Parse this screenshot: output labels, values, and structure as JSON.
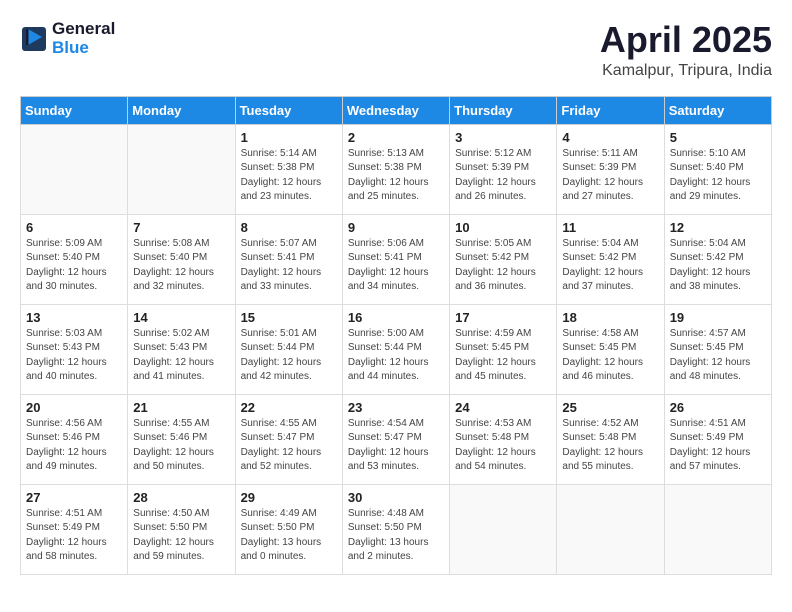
{
  "header": {
    "logo_general": "General",
    "logo_blue": "Blue",
    "month_title": "April 2025",
    "location": "Kamalpur, Tripura, India"
  },
  "weekdays": [
    "Sunday",
    "Monday",
    "Tuesday",
    "Wednesday",
    "Thursday",
    "Friday",
    "Saturday"
  ],
  "weeks": [
    [
      {
        "day": "",
        "info": ""
      },
      {
        "day": "",
        "info": ""
      },
      {
        "day": "1",
        "info": "Sunrise: 5:14 AM\nSunset: 5:38 PM\nDaylight: 12 hours\nand 23 minutes."
      },
      {
        "day": "2",
        "info": "Sunrise: 5:13 AM\nSunset: 5:38 PM\nDaylight: 12 hours\nand 25 minutes."
      },
      {
        "day": "3",
        "info": "Sunrise: 5:12 AM\nSunset: 5:39 PM\nDaylight: 12 hours\nand 26 minutes."
      },
      {
        "day": "4",
        "info": "Sunrise: 5:11 AM\nSunset: 5:39 PM\nDaylight: 12 hours\nand 27 minutes."
      },
      {
        "day": "5",
        "info": "Sunrise: 5:10 AM\nSunset: 5:40 PM\nDaylight: 12 hours\nand 29 minutes."
      }
    ],
    [
      {
        "day": "6",
        "info": "Sunrise: 5:09 AM\nSunset: 5:40 PM\nDaylight: 12 hours\nand 30 minutes."
      },
      {
        "day": "7",
        "info": "Sunrise: 5:08 AM\nSunset: 5:40 PM\nDaylight: 12 hours\nand 32 minutes."
      },
      {
        "day": "8",
        "info": "Sunrise: 5:07 AM\nSunset: 5:41 PM\nDaylight: 12 hours\nand 33 minutes."
      },
      {
        "day": "9",
        "info": "Sunrise: 5:06 AM\nSunset: 5:41 PM\nDaylight: 12 hours\nand 34 minutes."
      },
      {
        "day": "10",
        "info": "Sunrise: 5:05 AM\nSunset: 5:42 PM\nDaylight: 12 hours\nand 36 minutes."
      },
      {
        "day": "11",
        "info": "Sunrise: 5:04 AM\nSunset: 5:42 PM\nDaylight: 12 hours\nand 37 minutes."
      },
      {
        "day": "12",
        "info": "Sunrise: 5:04 AM\nSunset: 5:42 PM\nDaylight: 12 hours\nand 38 minutes."
      }
    ],
    [
      {
        "day": "13",
        "info": "Sunrise: 5:03 AM\nSunset: 5:43 PM\nDaylight: 12 hours\nand 40 minutes."
      },
      {
        "day": "14",
        "info": "Sunrise: 5:02 AM\nSunset: 5:43 PM\nDaylight: 12 hours\nand 41 minutes."
      },
      {
        "day": "15",
        "info": "Sunrise: 5:01 AM\nSunset: 5:44 PM\nDaylight: 12 hours\nand 42 minutes."
      },
      {
        "day": "16",
        "info": "Sunrise: 5:00 AM\nSunset: 5:44 PM\nDaylight: 12 hours\nand 44 minutes."
      },
      {
        "day": "17",
        "info": "Sunrise: 4:59 AM\nSunset: 5:45 PM\nDaylight: 12 hours\nand 45 minutes."
      },
      {
        "day": "18",
        "info": "Sunrise: 4:58 AM\nSunset: 5:45 PM\nDaylight: 12 hours\nand 46 minutes."
      },
      {
        "day": "19",
        "info": "Sunrise: 4:57 AM\nSunset: 5:45 PM\nDaylight: 12 hours\nand 48 minutes."
      }
    ],
    [
      {
        "day": "20",
        "info": "Sunrise: 4:56 AM\nSunset: 5:46 PM\nDaylight: 12 hours\nand 49 minutes."
      },
      {
        "day": "21",
        "info": "Sunrise: 4:55 AM\nSunset: 5:46 PM\nDaylight: 12 hours\nand 50 minutes."
      },
      {
        "day": "22",
        "info": "Sunrise: 4:55 AM\nSunset: 5:47 PM\nDaylight: 12 hours\nand 52 minutes."
      },
      {
        "day": "23",
        "info": "Sunrise: 4:54 AM\nSunset: 5:47 PM\nDaylight: 12 hours\nand 53 minutes."
      },
      {
        "day": "24",
        "info": "Sunrise: 4:53 AM\nSunset: 5:48 PM\nDaylight: 12 hours\nand 54 minutes."
      },
      {
        "day": "25",
        "info": "Sunrise: 4:52 AM\nSunset: 5:48 PM\nDaylight: 12 hours\nand 55 minutes."
      },
      {
        "day": "26",
        "info": "Sunrise: 4:51 AM\nSunset: 5:49 PM\nDaylight: 12 hours\nand 57 minutes."
      }
    ],
    [
      {
        "day": "27",
        "info": "Sunrise: 4:51 AM\nSunset: 5:49 PM\nDaylight: 12 hours\nand 58 minutes."
      },
      {
        "day": "28",
        "info": "Sunrise: 4:50 AM\nSunset: 5:50 PM\nDaylight: 12 hours\nand 59 minutes."
      },
      {
        "day": "29",
        "info": "Sunrise: 4:49 AM\nSunset: 5:50 PM\nDaylight: 13 hours\nand 0 minutes."
      },
      {
        "day": "30",
        "info": "Sunrise: 4:48 AM\nSunset: 5:50 PM\nDaylight: 13 hours\nand 2 minutes."
      },
      {
        "day": "",
        "info": ""
      },
      {
        "day": "",
        "info": ""
      },
      {
        "day": "",
        "info": ""
      }
    ]
  ]
}
